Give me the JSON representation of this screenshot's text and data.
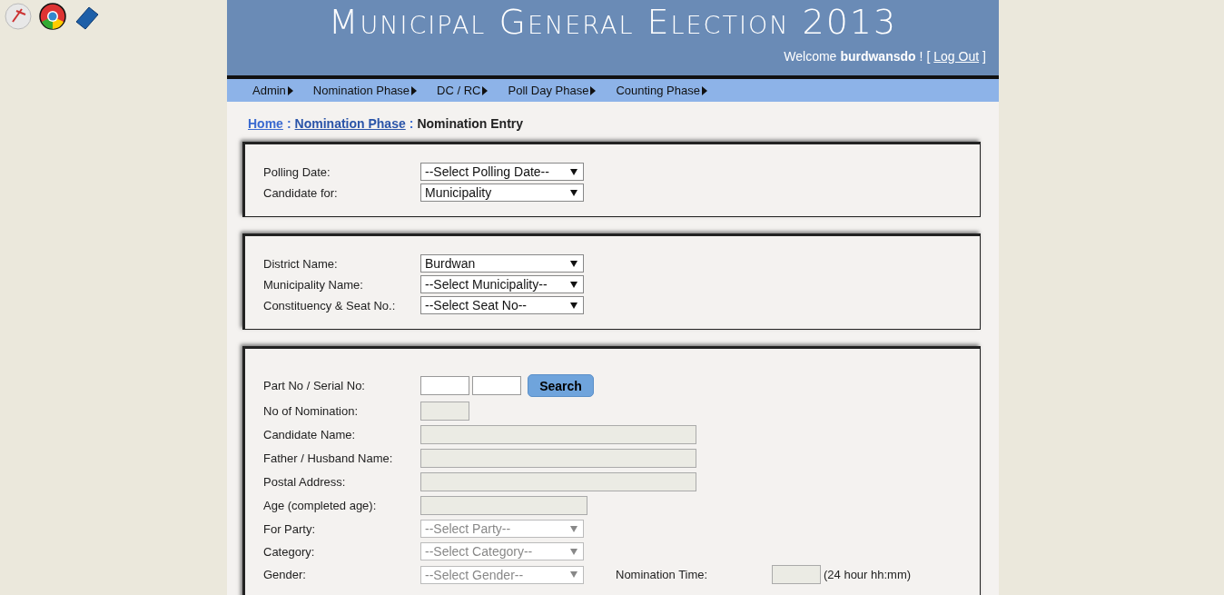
{
  "desktop_icons": [
    {
      "kind": "pdf"
    },
    {
      "kind": "browser"
    },
    {
      "kind": "help"
    }
  ],
  "header": {
    "title": "Municipal General Election 2013",
    "welcome": "Welcome",
    "user": "burdwansdo",
    "separator": "! [",
    "logout": "Log Out",
    "close": "]"
  },
  "menu": [
    {
      "label": "Admin"
    },
    {
      "label": "Nomination Phase"
    },
    {
      "label": "DC / RC"
    },
    {
      "label": "Poll Day Phase"
    },
    {
      "label": "Counting Phase"
    }
  ],
  "breadcrumb": [
    {
      "label": "Home",
      "kind": "link"
    },
    {
      "label": ":",
      "kind": "sep"
    },
    {
      "label": "Nomination Phase",
      "kind": "link"
    },
    {
      "label": ":",
      "kind": "sep"
    },
    {
      "label": "Nomination Entry",
      "kind": "current"
    }
  ],
  "panels": [
    {
      "rows": [
        {
          "label": "Polling Date:",
          "kind": "select",
          "value": "--Select Polling Date--",
          "disabled": false
        },
        {
          "label": "Candidate for:",
          "kind": "select",
          "value": "Municipality",
          "disabled": false
        }
      ]
    },
    {
      "rows": [
        {
          "label": "District Name:",
          "kind": "select",
          "value": "Burdwan",
          "disabled": false
        },
        {
          "label": "Municipality Name:",
          "kind": "select",
          "value": "--Select Municipality--",
          "disabled": false
        },
        {
          "label": "Constituency & Seat No.:",
          "kind": "select",
          "value": "--Select Seat No--",
          "disabled": false
        }
      ]
    },
    {
      "rows": [
        {
          "label": "Part No / Serial No:",
          "kind": "search",
          "button": "Search",
          "disabled": false
        },
        {
          "label": "No of Nomination:",
          "kind": "short",
          "disabled": true
        },
        {
          "label": "Candidate Name:",
          "kind": "long",
          "disabled": true
        },
        {
          "label": "Father / Husband Name:",
          "kind": "long",
          "disabled": true
        },
        {
          "label": "Postal Address:",
          "kind": "long",
          "disabled": true
        },
        {
          "label": "Age (completed age):",
          "kind": "medium",
          "disabled": true
        },
        {
          "label": "For Party:",
          "kind": "select",
          "value": "--Select Party--",
          "disabled": true
        },
        {
          "label": "Category:",
          "kind": "select",
          "value": "--Select Category--",
          "disabled": true
        },
        {
          "label": "Gender:",
          "kind": "select",
          "value": "--Select Gender--",
          "disabled": true,
          "extra": {
            "label": "Nomination Time:",
            "hint": "(24 hour hh:mm)",
            "disabled": true
          }
        }
      ]
    }
  ]
}
